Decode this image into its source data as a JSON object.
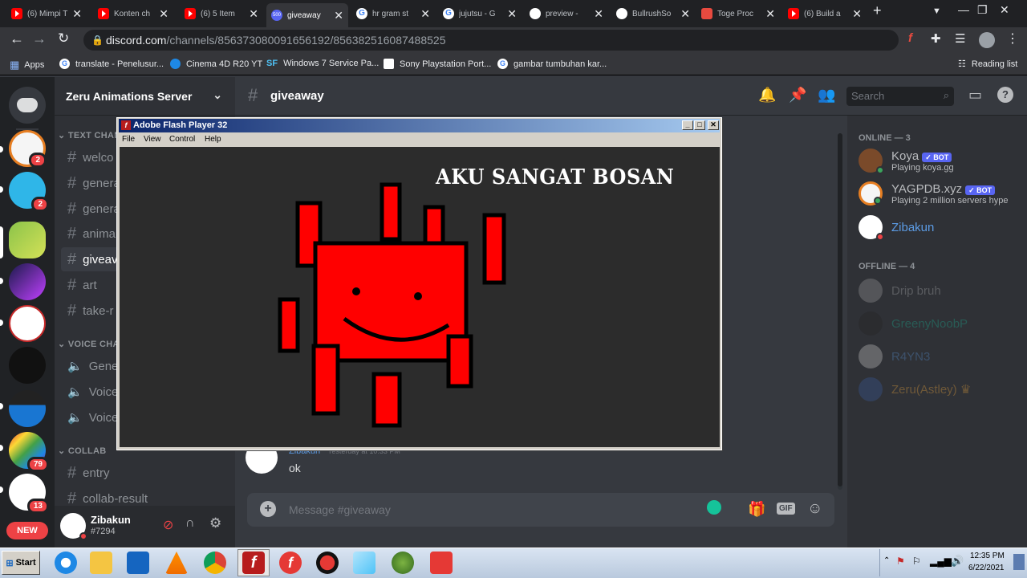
{
  "browser": {
    "tabs": [
      {
        "label": "(6) Mimpi T",
        "icon": "youtube-icon"
      },
      {
        "label": "Konten ch",
        "icon": "youtube-icon"
      },
      {
        "label": "(6) 5 Item",
        "icon": "youtube-icon"
      },
      {
        "label": "giveaway",
        "icon": "discord-icon",
        "active": true,
        "badge": "500"
      },
      {
        "label": "hr gram st",
        "icon": "google-icon"
      },
      {
        "label": "jujutsu - G",
        "icon": "google-icon"
      },
      {
        "label": "preview -",
        "icon": "github-icon"
      },
      {
        "label": "BullrushSo",
        "icon": "github-icon"
      },
      {
        "label": "Toge Proc",
        "icon": "app-icon"
      },
      {
        "label": "(6) Build a",
        "icon": "youtube-icon"
      }
    ],
    "url_host": "discord.com",
    "url_path": "/channels/856373080091656192/856382516087488525",
    "bookmarks": [
      "Apps",
      "translate - Penelusur...",
      "Cinema 4D R20 YT",
      "Windows 7 Service Pa...",
      "Sony Playstation Port...",
      "gambar tumbuhan kar..."
    ],
    "bookmark_sf": "SF",
    "reading_list": "Reading list"
  },
  "discord": {
    "server_name": "Zeru Animations Server",
    "categories": {
      "text": "TEXT CHAN",
      "voice": "VOICE CHA",
      "collab": "COLLAB"
    },
    "text_channels": [
      "welco",
      "genera",
      "genera",
      "anima",
      "giveav",
      "art",
      "take-r"
    ],
    "voice_channels": [
      "Gener",
      "Voice",
      "Voice"
    ],
    "collab_channels": [
      "entry",
      "collab-result"
    ],
    "guild_badges": [
      "2",
      "2",
      "79",
      "13"
    ],
    "new_label": "NEW",
    "channel_title": "giveaway",
    "search_placeholder": "Search",
    "message": {
      "author": "Zibakun",
      "time": "Yesterday at 10:33 PM",
      "text": "ok"
    },
    "input_placeholder": "Message #giveaway",
    "gif_label": "GIF",
    "user": {
      "name": "Zibakun",
      "tag": "#7294"
    },
    "members": {
      "online_header": "ONLINE — 3",
      "offline_header": "OFFLINE — 4",
      "online": [
        {
          "name": "Koya",
          "status": "Playing koya.gg",
          "bot": "BOT",
          "color": "#b9bbbe"
        },
        {
          "name": "YAGPDB.xyz",
          "status": "Playing 2 million servers hype",
          "bot": "BOT",
          "color": "#b9bbbe"
        },
        {
          "name": "Zibakun",
          "status": "",
          "color": "#5c9ce6"
        }
      ],
      "offline": [
        "Drip bruh",
        "GreenyNoobP",
        "R4YN3",
        "Zeru(Astley)"
      ]
    }
  },
  "flash": {
    "title": "Adobe Flash Player 32",
    "menu": [
      "File",
      "View",
      "Control",
      "Help"
    ],
    "stage_text": "AKU SANGAT BOSAN"
  },
  "taskbar": {
    "start": "Start",
    "time": "12:35 PM",
    "date": "6/22/2021"
  }
}
